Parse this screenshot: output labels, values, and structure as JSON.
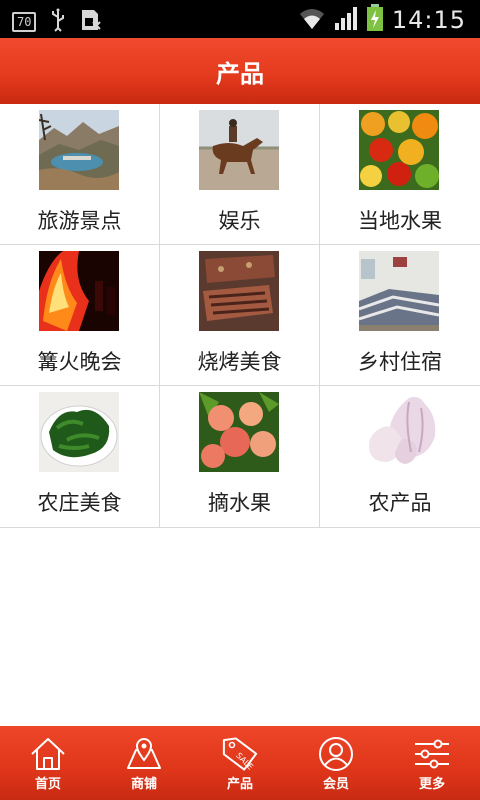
{
  "status_bar": {
    "badge": "70",
    "time": "14:15",
    "icons": [
      "notification-badge-icon",
      "usb-icon",
      "sim-icon",
      "wifi-icon",
      "signal-icon",
      "battery-charging-icon"
    ]
  },
  "header": {
    "title": "产品"
  },
  "products": [
    {
      "label": "旅游景点",
      "icon": "scenic-spot-photo"
    },
    {
      "label": "娱乐",
      "icon": "horse-riding-photo"
    },
    {
      "label": "当地水果",
      "icon": "local-fruit-photo"
    },
    {
      "label": "篝火晚会",
      "icon": "bonfire-photo"
    },
    {
      "label": "烧烤美食",
      "icon": "bbq-photo"
    },
    {
      "label": "乡村住宿",
      "icon": "rural-lodging-photo"
    },
    {
      "label": "农庄美食",
      "icon": "farm-food-photo"
    },
    {
      "label": "摘水果",
      "icon": "peach-picking-photo"
    },
    {
      "label": "农产品",
      "icon": "garlic-photo"
    }
  ],
  "bottom_nav": {
    "items": [
      {
        "label": "首页",
        "icon": "home-icon"
      },
      {
        "label": "商铺",
        "icon": "map-icon"
      },
      {
        "label": "产品",
        "icon": "sale-tag-icon"
      },
      {
        "label": "会员",
        "icon": "user-icon"
      },
      {
        "label": "更多",
        "icon": "sliders-icon"
      }
    ]
  },
  "colors": {
    "accent": "#e53b1e",
    "divider": "#d9d9d9",
    "text": "#222222"
  }
}
